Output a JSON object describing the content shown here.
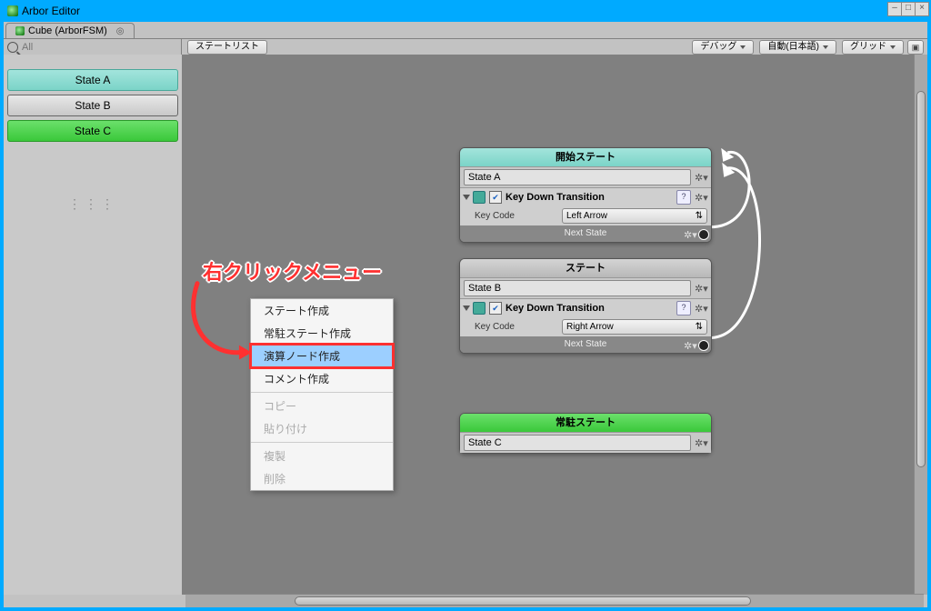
{
  "window": {
    "title": "Arbor Editor"
  },
  "tabs": {
    "object": "Cube (ArborFSM)"
  },
  "search": {
    "placeholder": "All"
  },
  "toolbar": {
    "state_list": "ステートリスト",
    "debug": "デバッグ",
    "language": "自動(日本語)",
    "grid": "グリッド"
  },
  "sidebar": {
    "items": [
      {
        "label": "State A",
        "style": "teal"
      },
      {
        "label": "State B",
        "style": ""
      },
      {
        "label": "State C",
        "style": "green"
      }
    ]
  },
  "nodes": {
    "start": {
      "title": "開始ステート",
      "name": "State A",
      "behaviour": "Key Down Transition",
      "key_code_label": "Key Code",
      "key_code_value": "Left Arrow",
      "footer": "Next State"
    },
    "normal": {
      "title": "ステート",
      "name": "State B",
      "behaviour": "Key Down Transition",
      "key_code_label": "Key Code",
      "key_code_value": "Right Arrow",
      "footer": "Next State"
    },
    "resident": {
      "title": "常駐ステート",
      "name": "State C"
    }
  },
  "context_menu": {
    "create_state": "ステート作成",
    "create_resident": "常駐ステート作成",
    "create_calc": "演算ノード作成",
    "create_comment": "コメント作成",
    "copy": "コピー",
    "paste": "貼り付け",
    "duplicate": "複製",
    "delete": "削除"
  },
  "annotation": {
    "text": "右クリックメニュー"
  }
}
